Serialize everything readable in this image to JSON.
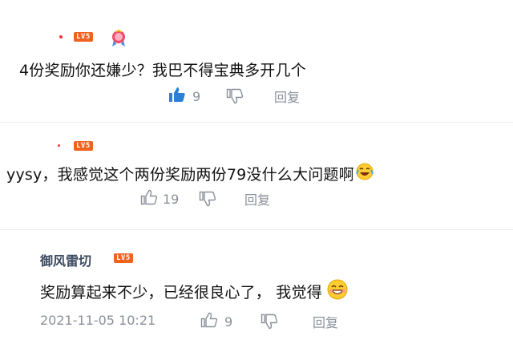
{
  "comments": [
    {
      "level": "LV5",
      "text": "4份奖励你还嫌少？我巴不得宝典多开几个",
      "likes": "9",
      "reply_label": "回复"
    },
    {
      "level": "LV5",
      "text": "yysy，我感觉这个两份奖励两份79没什么大问题啊",
      "likes": "19",
      "reply_label": "回复"
    },
    {
      "username": "御风雷切",
      "level": "LV5",
      "text": "奖励算起来不少，已经很良心了，  我觉得",
      "timestamp": "2021-11-05 10:21",
      "likes": "9",
      "reply_label": "回复"
    }
  ],
  "colors": {
    "badge": "#f0621f",
    "like_active": "#2b7fd4",
    "muted": "#8a8f99"
  }
}
